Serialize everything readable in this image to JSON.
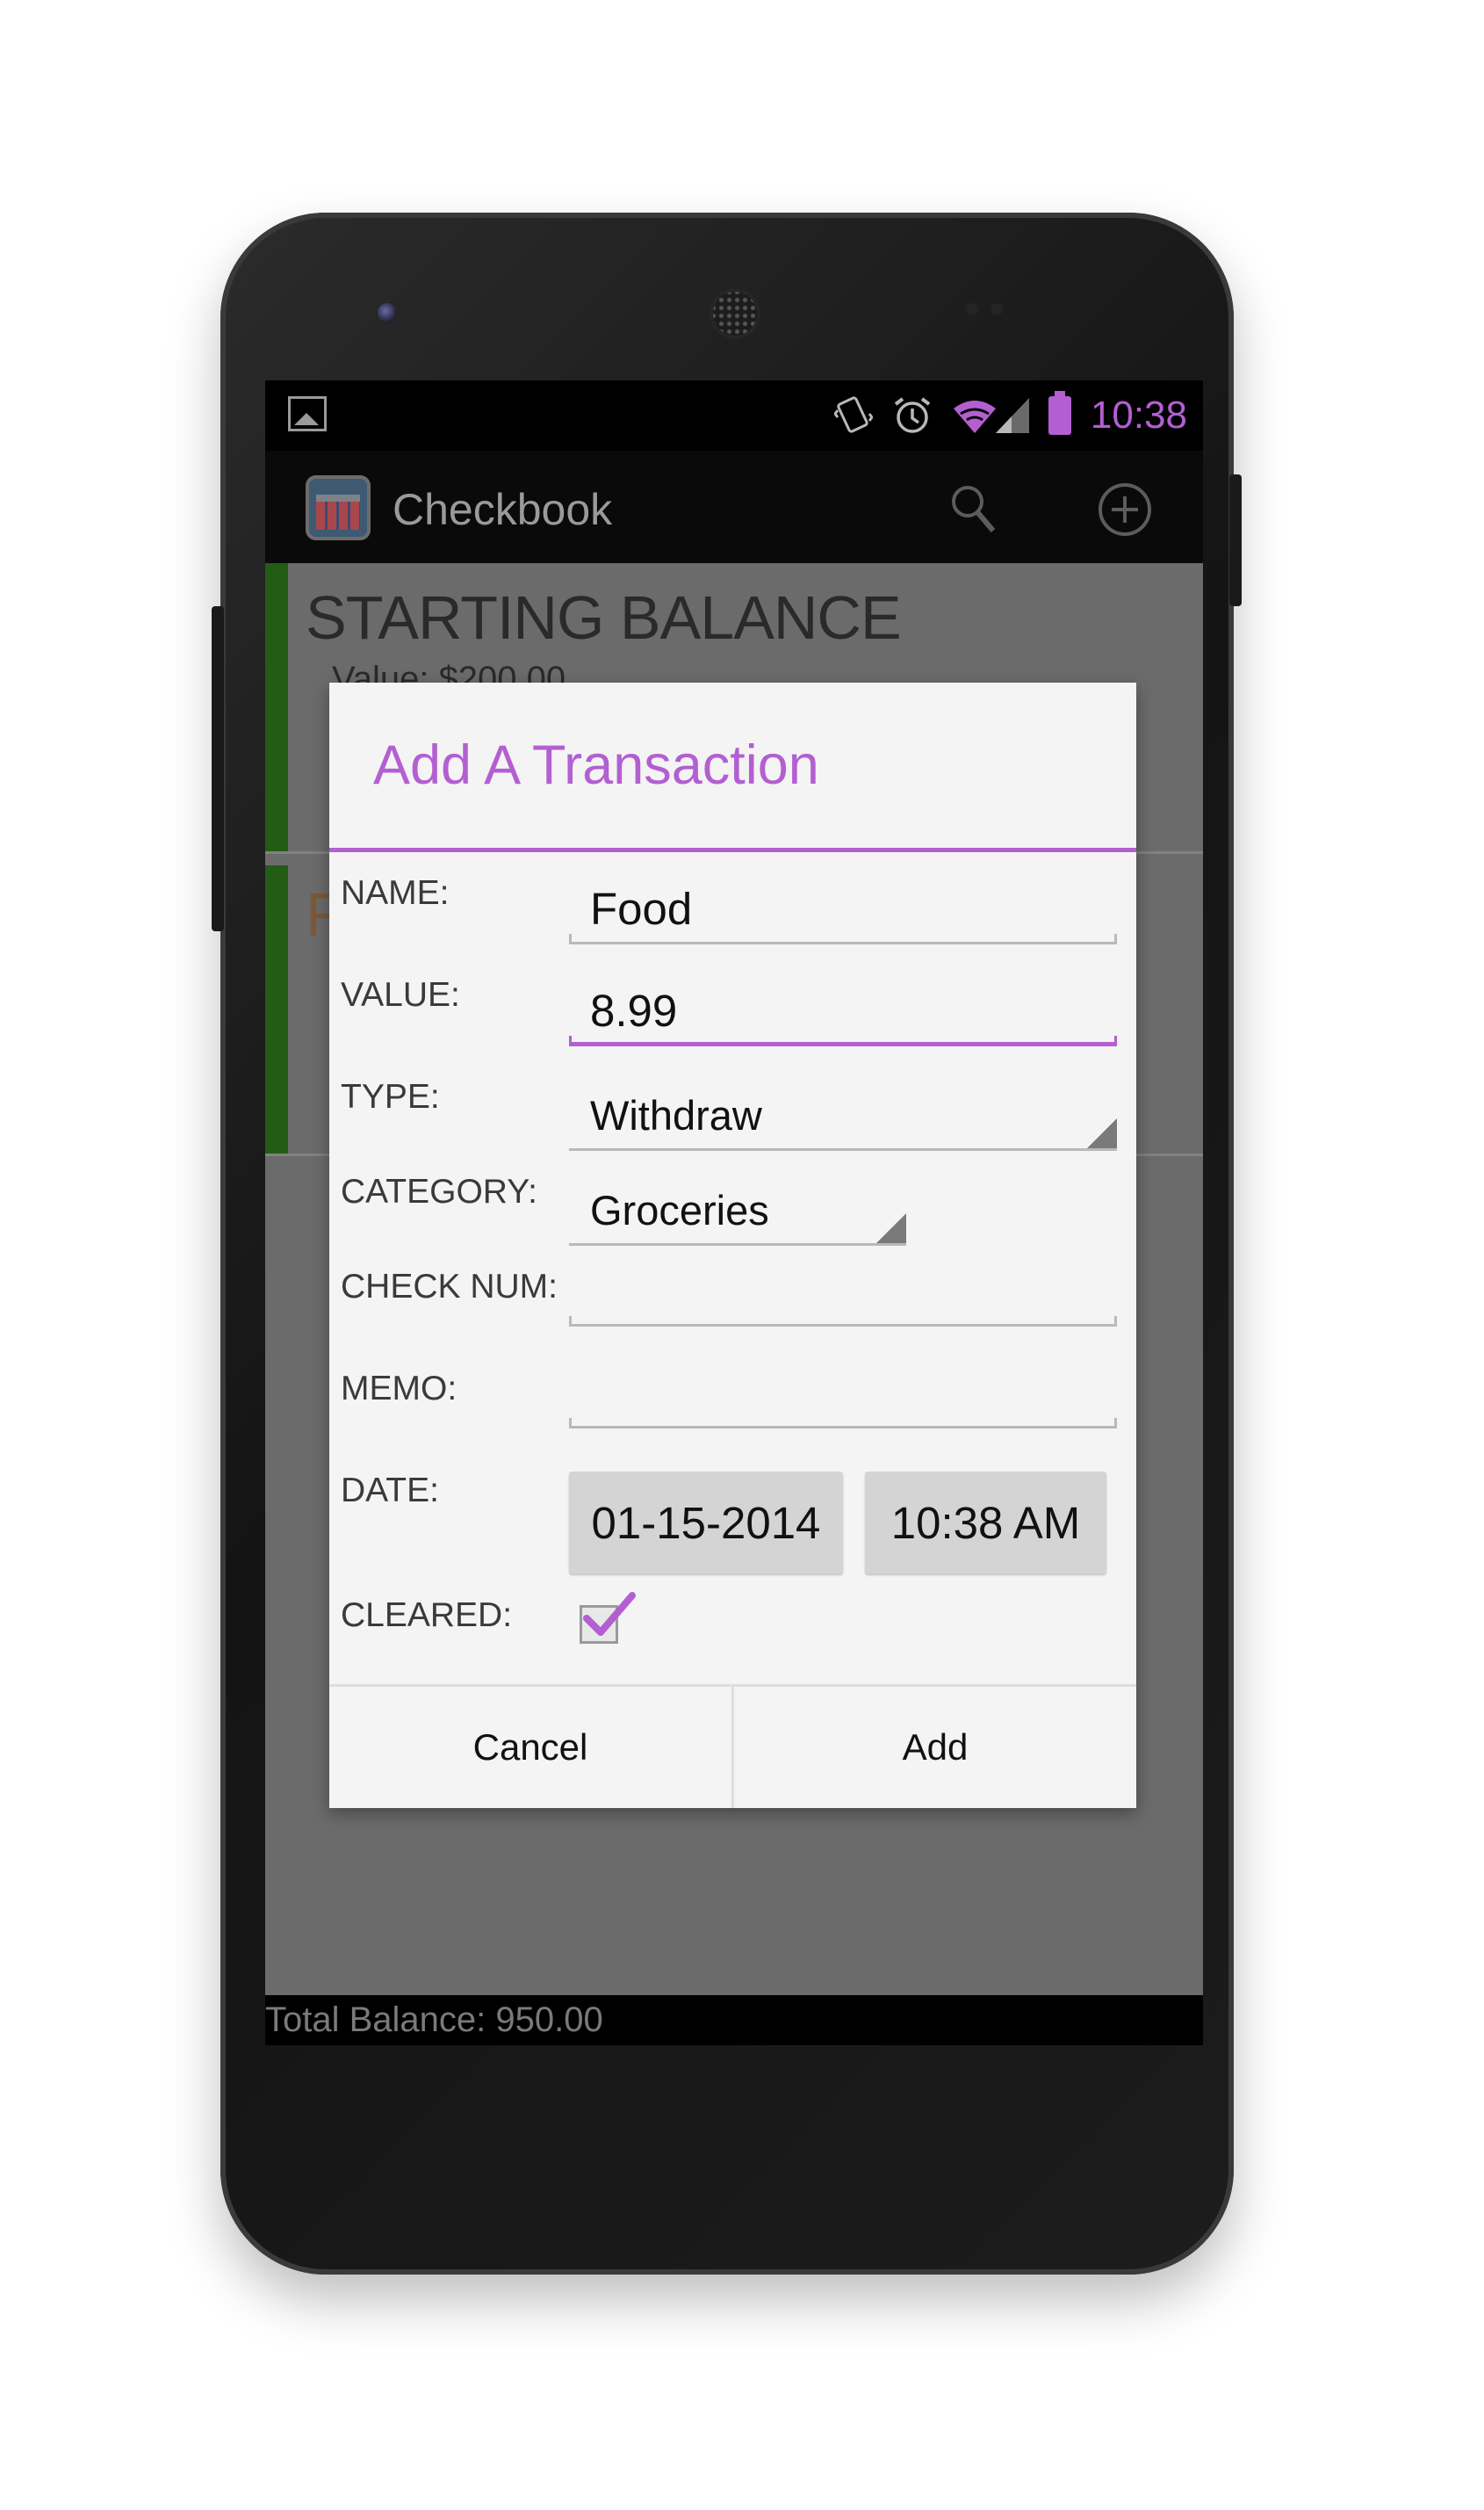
{
  "status_bar": {
    "time": "10:38",
    "icons": [
      "image-icon",
      "vibrate-icon",
      "alarm-icon",
      "wifi-icon",
      "signal-icon",
      "battery-icon"
    ],
    "accent_color": "#b35fd1"
  },
  "action_bar": {
    "title": "Checkbook",
    "icons": [
      "search-icon",
      "add-circle-icon"
    ]
  },
  "background_list": {
    "row1_title": "STARTING BALANCE",
    "row1_value": "Value: $200.00",
    "row2_title": "F"
  },
  "footer": {
    "total_balance": "Total Balance: 950.00"
  },
  "dialog": {
    "title": "Add A Transaction",
    "labels": {
      "name": "NAME:",
      "value": "VALUE:",
      "type": "TYPE:",
      "category": "CATEGORY:",
      "check_num": "CHECK NUM:",
      "memo": "MEMO:",
      "date": "DATE:",
      "cleared": "CLEARED:"
    },
    "fields": {
      "name": "Food",
      "value": "8.99",
      "type": "Withdraw",
      "category": "Groceries",
      "check_num": "",
      "memo": "",
      "date": "01-15-2014",
      "time": "10:38 AM",
      "cleared": true
    },
    "buttons": {
      "cancel": "Cancel",
      "add": "Add"
    }
  }
}
